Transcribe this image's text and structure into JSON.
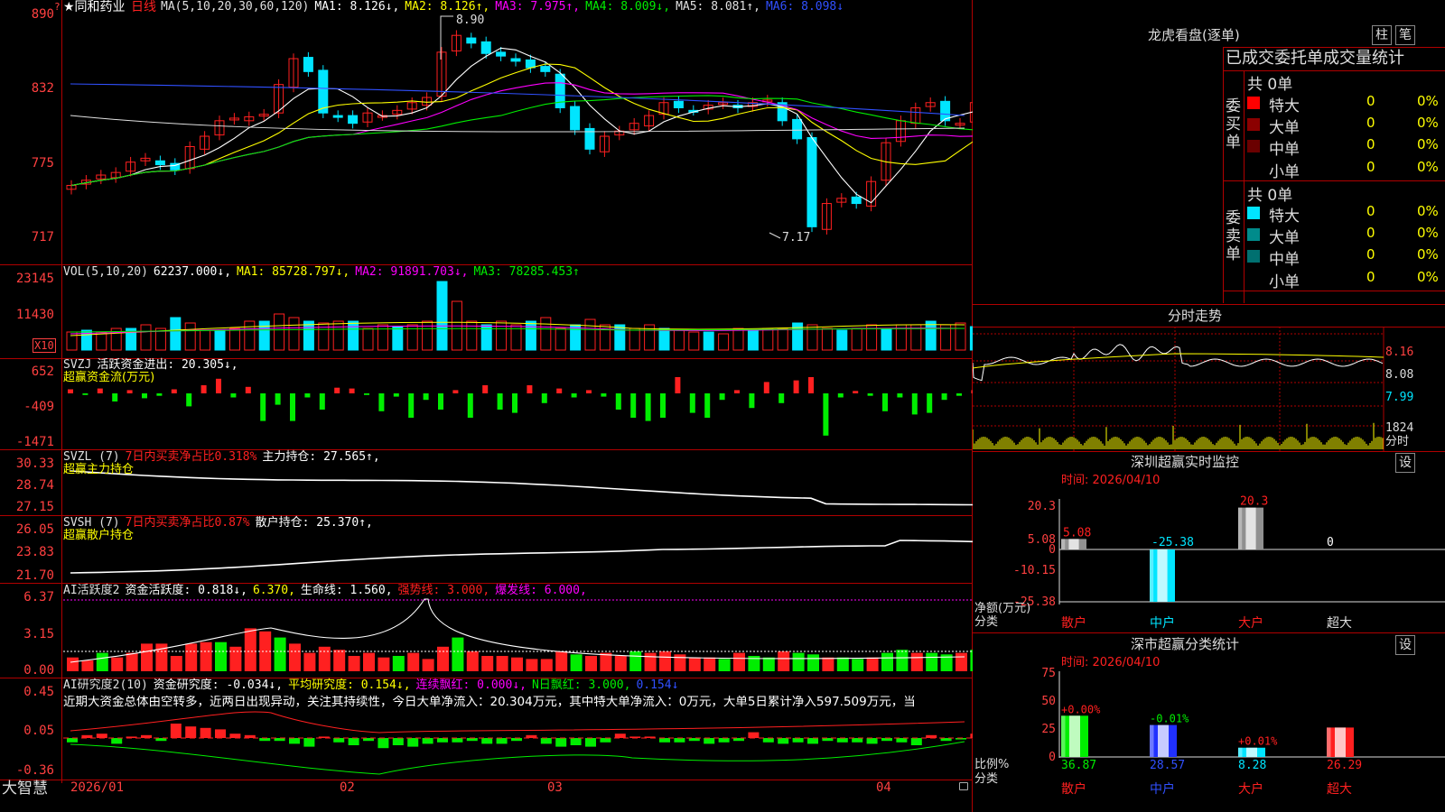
{
  "colors": {
    "up": "#ff2020",
    "down": "#00e5ff",
    "green": "#00ee00",
    "yellow": "#ffff00",
    "magenta": "#ff00ff",
    "white": "#ffffff",
    "grid": "#b00000",
    "axis_label": "#ff4040"
  },
  "main": {
    "title": "★同和药业",
    "period": "日线",
    "ma_legend": [
      {
        "text": "MA(5,10,20,30,60,120)",
        "color": "#e0e0e0"
      },
      {
        "text": "MA1: 8.126↓,",
        "color": "#ffffff"
      },
      {
        "text": "MA2: 8.126↑,",
        "color": "#ffff00"
      },
      {
        "text": "MA3: 7.975↑,",
        "color": "#ff00ff"
      },
      {
        "text": "MA4: 8.009↓,",
        "color": "#00ee00"
      },
      {
        "text": "MA5: 8.081↑,",
        "color": "#e0e0e0"
      },
      {
        "text": "MA6: 8.098↓",
        "color": "#3050ff"
      }
    ],
    "yticks": [
      "890",
      "832",
      "775",
      "717"
    ],
    "high_label": "8.90",
    "low_label": "7.17",
    "corner_mark": "?"
  },
  "vol": {
    "legend": [
      {
        "text": "VOL(5,10,20)",
        "color": "#e0e0e0"
      },
      {
        "text": "62237.000↓,",
        "color": "#ffffff"
      },
      {
        "text": "MA1: 85728.797↓,",
        "color": "#ffff00"
      },
      {
        "text": "MA2: 91891.703↓,",
        "color": "#ff00ff"
      },
      {
        "text": "MA3: 78285.453↑",
        "color": "#00ee00"
      }
    ],
    "yticks": [
      "23145",
      "11430"
    ],
    "unit": "X10"
  },
  "svzj": {
    "legend": [
      {
        "text": "SVZJ",
        "color": "#e0e0e0"
      },
      {
        "text": "活跃资金进出: 20.305↓,",
        "color": "#ffffff"
      }
    ],
    "sub": "超赢资金流(万元)",
    "yticks": [
      "652",
      "-409",
      "-1471"
    ]
  },
  "svzl": {
    "legend": [
      {
        "text": "SVZL (7)",
        "color": "#e0e0e0"
      },
      {
        "text": "7日内买卖净占比0.318%",
        "color": "#ff2020"
      },
      {
        "text": "主力持仓: 27.565↑,",
        "color": "#ffffff"
      }
    ],
    "sub": "超赢主力持仓",
    "yticks": [
      "30.33",
      "28.74",
      "27.15"
    ]
  },
  "svsh": {
    "legend": [
      {
        "text": "SVSH (7)",
        "color": "#e0e0e0"
      },
      {
        "text": "7日内买卖净占比0.87%",
        "color": "#ff2020"
      },
      {
        "text": "散户持仓: 25.370↑,",
        "color": "#ffffff"
      }
    ],
    "sub": "超赢散户持仓",
    "yticks": [
      "26.05",
      "23.83",
      "21.70"
    ]
  },
  "ai1": {
    "legend": [
      {
        "text": "AI活跃度2",
        "color": "#e0e0e0"
      },
      {
        "text": "资金活跃度: 0.818↓,",
        "color": "#ffffff"
      },
      {
        "text": "6.370,",
        "color": "#ffff00"
      },
      {
        "text": "生命线: 1.560,",
        "color": "#ffffff"
      },
      {
        "text": "强势线: 3.000,",
        "color": "#ff2020"
      },
      {
        "text": "爆发线: 6.000,",
        "color": "#ff00ff"
      }
    ],
    "yticks": [
      "6.37",
      "3.15",
      "0.00"
    ]
  },
  "ai2": {
    "legend": [
      {
        "text": "AI研究度2(10)",
        "color": "#e0e0e0"
      },
      {
        "text": "资金研究度: -0.034↓,",
        "color": "#ffffff"
      },
      {
        "text": "平均研究度: 0.154↓,",
        "color": "#ffff00"
      },
      {
        "text": "连续飘红: 0.000↓,",
        "color": "#ff00ff"
      },
      {
        "text": "N日飘红: 3.000,",
        "color": "#00ee00"
      },
      {
        "text": "0.154↓",
        "color": "#3050ff"
      }
    ],
    "comment": "近期大资金总体由空转多，近两日出现异动，关注其持续性，今日大单净流入：20.304万元，其中特大单净流入：0万元，大单5日累计净入597.509万元，当",
    "yticks": [
      "0.45",
      "0.05",
      "-0.36"
    ]
  },
  "xaxis": {
    "labels": [
      "2026/01",
      "02",
      "03",
      "04"
    ],
    "brand": "大智慧"
  },
  "right": {
    "lhkp": {
      "title": "龙虎看盘(逐单)",
      "btn1": "柱",
      "btn2": "笔"
    },
    "order_header": "已成交委托单成交量统计",
    "buy_label": "委买单",
    "sell_label": "委卖单",
    "buy_total": "共 0单",
    "sell_total": "共 0单",
    "rows": [
      {
        "label": "特大",
        "value": "0",
        "pct": "0%"
      },
      {
        "label": "大单",
        "value": "0",
        "pct": "0%"
      },
      {
        "label": "中单",
        "value": "0",
        "pct": "0%"
      },
      {
        "label": "小单",
        "value": "0",
        "pct": "0%"
      }
    ],
    "intraday": {
      "title": "分时走势",
      "prices": [
        "8.16",
        "8.08",
        "7.99"
      ],
      "vol": "1824",
      "vol_unit": "分时"
    },
    "sz_monitor": {
      "title": "深圳超赢实时监控",
      "btn": "设",
      "time": "时间: 2026/04/10",
      "yticks": [
        "20.3",
        "5.08",
        "0",
        "-10.15",
        "-25.38"
      ],
      "ylabel": "净额(万元)",
      "xlabel": "分类",
      "categories": [
        "散户",
        "中户",
        "大户",
        "超大"
      ],
      "values": [
        "5.08",
        "-25.38",
        "20.3",
        "0"
      ]
    },
    "sh_class": {
      "title": "深市超赢分类统计",
      "btn": "设",
      "time": "时间: 2026/04/10",
      "yticks": [
        "75",
        "50",
        "25",
        "0"
      ],
      "ylabel": "比例%",
      "xlabel": "分类",
      "categories": [
        "散户",
        "中户",
        "大户",
        "超大"
      ],
      "changes": [
        "+0.00%",
        "-0.01%",
        "+0.01%",
        ""
      ],
      "values": [
        "36.87",
        "28.57",
        "8.28",
        "26.29"
      ]
    }
  }
}
